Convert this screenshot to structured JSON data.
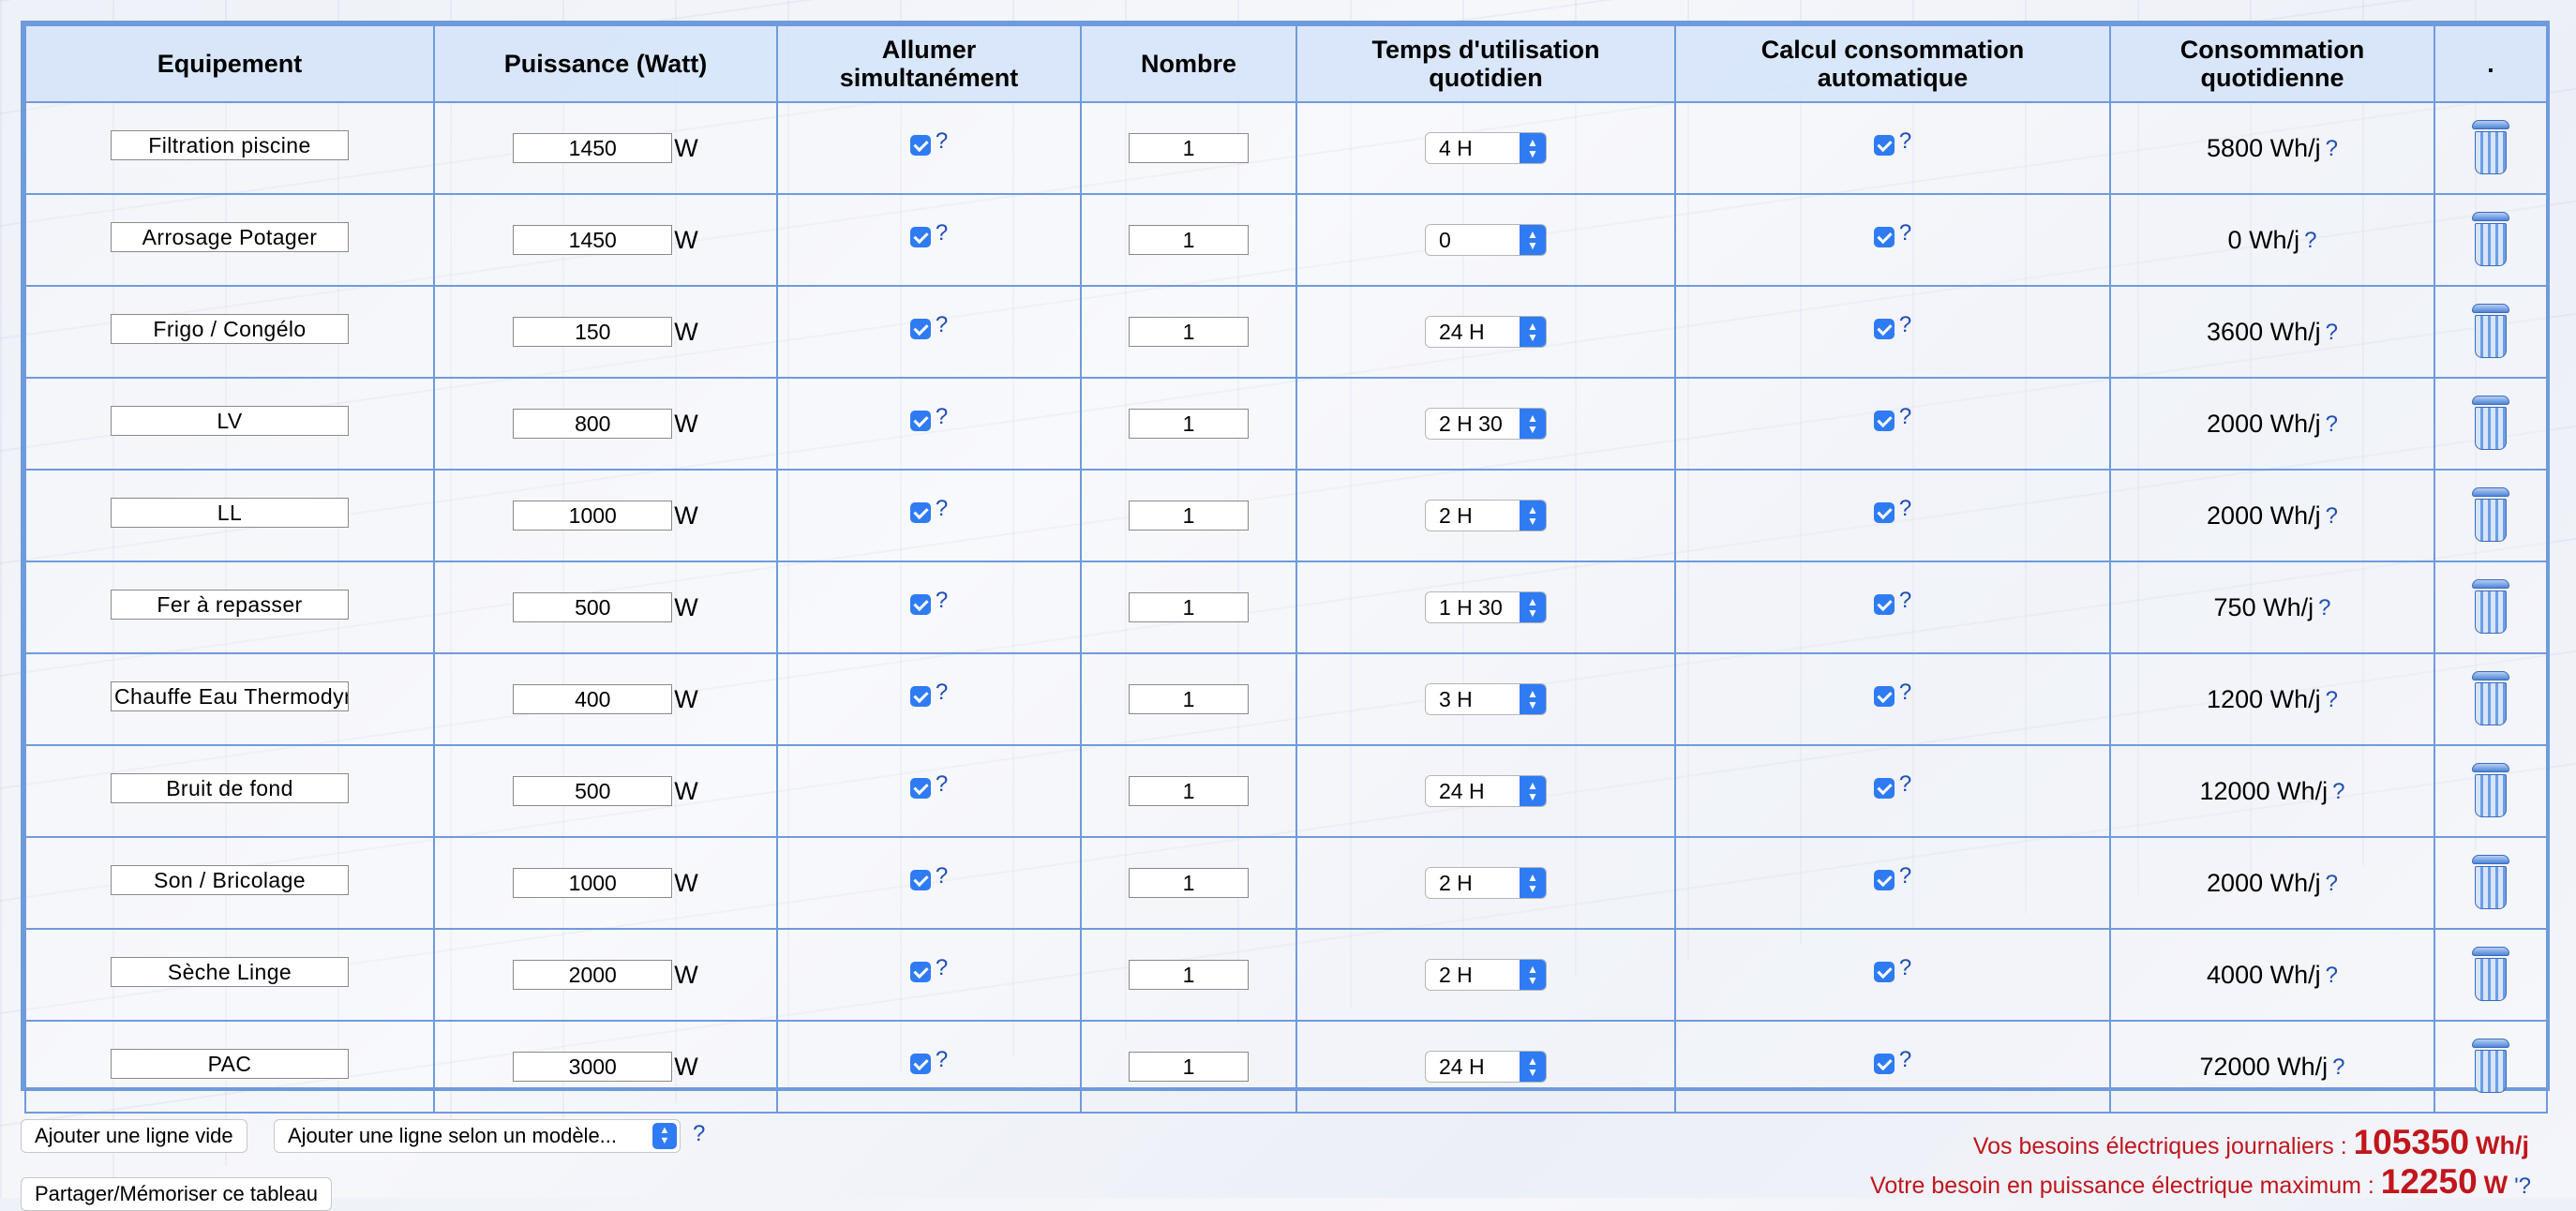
{
  "headers": {
    "equipment": "Equipement",
    "power": "Puissance (Watt)",
    "simultaneous_l1": "Allumer",
    "simultaneous_l2": "simultanément",
    "count": "Nombre",
    "time_l1": "Temps d'utilisation",
    "time_l2": "quotidien",
    "auto_l1": "Calcul consommation",
    "auto_l2": "automatique",
    "conso_l1": "Consommation",
    "conso_l2": "quotidienne",
    "actions": "."
  },
  "unit_w": "W",
  "help_mark": "?",
  "rows": [
    {
      "name": "Filtration piscine",
      "power": "1450",
      "simultaneous": true,
      "count": "1",
      "time": "4 H",
      "auto": true,
      "conso": "5800 Wh/j"
    },
    {
      "name": "Arrosage Potager",
      "power": "1450",
      "simultaneous": true,
      "count": "1",
      "time": "0",
      "auto": true,
      "conso": "0 Wh/j"
    },
    {
      "name": "Frigo / Congélo",
      "power": "150",
      "simultaneous": true,
      "count": "1",
      "time": "24 H",
      "auto": true,
      "conso": "3600 Wh/j"
    },
    {
      "name": "LV",
      "power": "800",
      "simultaneous": true,
      "count": "1",
      "time": "2 H 30",
      "auto": true,
      "conso": "2000 Wh/j"
    },
    {
      "name": "LL",
      "power": "1000",
      "simultaneous": true,
      "count": "1",
      "time": "2 H",
      "auto": true,
      "conso": "2000 Wh/j"
    },
    {
      "name": "Fer à repasser",
      "power": "500",
      "simultaneous": true,
      "count": "1",
      "time": "1 H 30",
      "auto": true,
      "conso": "750 Wh/j"
    },
    {
      "name": "Chauffe Eau Thermodyr",
      "power": "400",
      "simultaneous": true,
      "count": "1",
      "time": "3 H",
      "auto": true,
      "conso": "1200 Wh/j"
    },
    {
      "name": "Bruit de fond",
      "power": "500",
      "simultaneous": true,
      "count": "1",
      "time": "24 H",
      "auto": true,
      "conso": "12000 Wh/j"
    },
    {
      "name": "Son / Bricolage",
      "power": "1000",
      "simultaneous": true,
      "count": "1",
      "time": "2 H",
      "auto": true,
      "conso": "2000 Wh/j"
    },
    {
      "name": "Sèche Linge",
      "power": "2000",
      "simultaneous": true,
      "count": "1",
      "time": "2 H",
      "auto": true,
      "conso": "4000 Wh/j"
    },
    {
      "name": "PAC",
      "power": "3000",
      "simultaneous": true,
      "count": "1",
      "time": "24 H",
      "auto": true,
      "conso": "72000 Wh/j"
    }
  ],
  "footer": {
    "add_empty_label": "Ajouter une ligne vide",
    "add_model_label": "Ajouter une ligne selon un modèle...",
    "share_label": "Partager/Mémoriser ce tableau",
    "daily_needs_label": "Vos besoins électriques journaliers :",
    "daily_needs_value": "105350",
    "daily_needs_unit": "Wh/j",
    "max_power_label": "Votre besoin en puissance électrique maximum :",
    "max_power_value": "12250",
    "max_power_unit": "W",
    "max_power_help": "'?"
  },
  "colors": {
    "border": "#6f9bdc",
    "header_bg": "#d6e4fa",
    "accent": "#2f7bf3",
    "summary_text": "#c0161c",
    "help_mark": "#1f4fb5"
  },
  "icons": [
    "checkbox-checked-icon",
    "select-arrows-icon",
    "trash-icon"
  ]
}
